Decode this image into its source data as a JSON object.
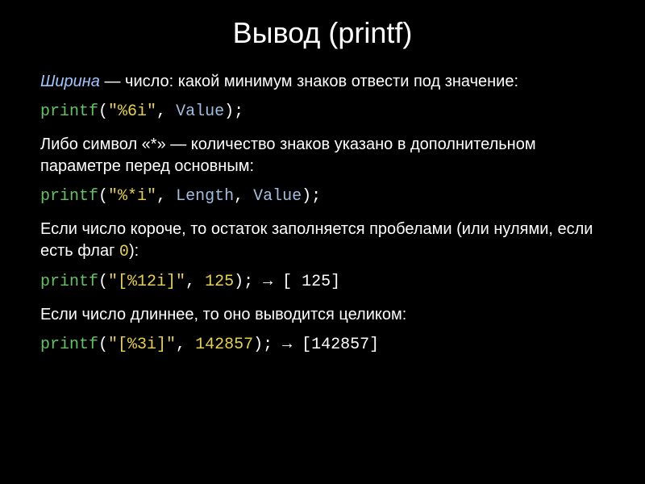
{
  "title": "Вывод (printf)",
  "p1": {
    "term": "Ширина",
    "rest": " — число: какой минимум знаков отвести под значение:"
  },
  "code1": {
    "fn": "printf",
    "open": "(",
    "str": "\"%6i\"",
    "comma": ", ",
    "arg": "Value",
    "close": ");"
  },
  "p2": "Либо символ «*» — количество знаков указано в дополнительном параметре перед основным:",
  "code2": {
    "fn": "printf",
    "open": "(",
    "str": "\"%*i\"",
    "comma1": ", ",
    "arg1": "Length",
    "comma2": ", ",
    "arg2": "Value",
    "close": ");"
  },
  "p3a": "Если число короче, то остаток заполняется пробелами (или нулями, если есть флаг ",
  "p3flag": "0",
  "p3b": "):",
  "code3": {
    "fn": "printf",
    "open": "(",
    "str": "\"[%12i]\"",
    "comma": ", ",
    "num": "125",
    "close": ");",
    "arrow": " → ",
    "out": "[         125]"
  },
  "p4": "Если число длиннее, то оно выводится целиком:",
  "code4": {
    "fn": "printf",
    "open": "(",
    "str": "\"[%3i]\"",
    "comma": ", ",
    "num": "142857",
    "close": ");",
    "arrow": " → ",
    "out": "[142857]"
  }
}
